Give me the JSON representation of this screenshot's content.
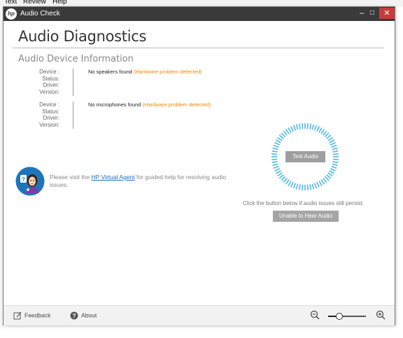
{
  "background_app": {
    "menu": [
      "Text",
      "Review",
      "Help"
    ]
  },
  "window": {
    "title": "Audio Check",
    "logo_text": "hp",
    "controls": {
      "minimize": "–",
      "maximize": "□",
      "close": "✕"
    }
  },
  "main": {
    "heading": "Audio Diagnostics",
    "section_title": "Audio Device Information"
  },
  "devices": [
    {
      "labels": [
        "Device :",
        "Status:",
        "Driver:",
        "Version:"
      ],
      "value": "No speakers found",
      "warning": "(Hardware problem detected)"
    },
    {
      "labels": [
        "Device :",
        "Status:",
        "Driver:",
        "Version:"
      ],
      "value": "No microphones found",
      "warning": "(Hardware problem detected)"
    }
  ],
  "test": {
    "button_label": "Test Audio",
    "persist_text": "Click the button below if audio issues still persist.",
    "unable_label": "Unable to Hear Audio"
  },
  "agent": {
    "text_before": "Please visit the",
    "link_text": "HP Virtual Agent",
    "text_after": "for guided help for resolving audio issues."
  },
  "footer": {
    "feedback_label": "Feedback",
    "about_label": "About",
    "zoom_level": 0.3
  },
  "colors": {
    "titlebar": "#3a3a3a",
    "warning": "#e98b00",
    "ring": "#4db8e6",
    "link": "#1b6fc0"
  },
  "icons": {
    "logo": "hp-logo-icon",
    "feedback": "feedback-icon",
    "about": "help-circle-icon",
    "zoom_out": "zoom-out-icon",
    "zoom_in": "zoom-in-icon",
    "agent": "virtual-agent-avatar-icon"
  }
}
